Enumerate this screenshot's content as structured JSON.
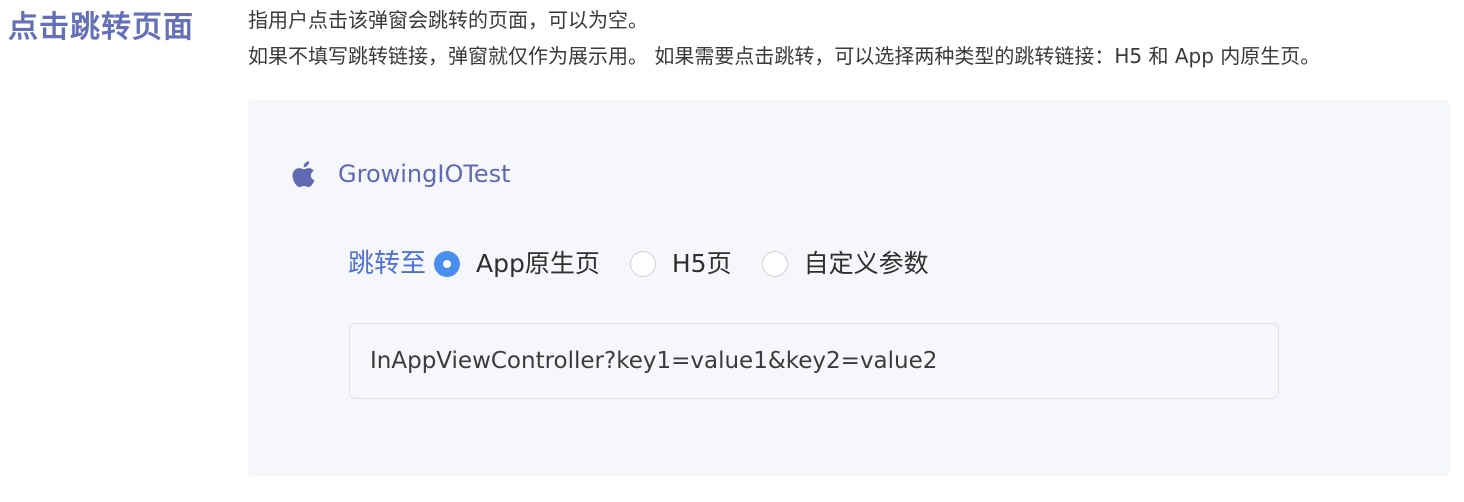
{
  "section": {
    "title": "点击跳转页面",
    "desc_line1": "指用户点击该弹窗会跳转的页面，可以为空。",
    "desc_line2": "如果不填写跳转链接，弹窗就仅作为展示用。 如果需要点击跳转，可以选择两种类型的跳转链接：H5 和 App 内原生页。"
  },
  "panel": {
    "app": {
      "icon": "apple-icon",
      "name": "GrowingIOTest"
    },
    "jump": {
      "label": "跳转至",
      "options": [
        {
          "label": "App原生页",
          "checked": true
        },
        {
          "label": "H5页",
          "checked": false
        },
        {
          "label": "自定义参数",
          "checked": false
        }
      ]
    },
    "url": {
      "value": "InAppViewController?key1=value1&key2=value2"
    }
  },
  "colors": {
    "title": "#6471b8",
    "app_name": "#5f6ab0",
    "jump_label": "#4f72d8",
    "radio_checked": "#4a8ef0",
    "panel_bg": "#f6f7fb"
  }
}
